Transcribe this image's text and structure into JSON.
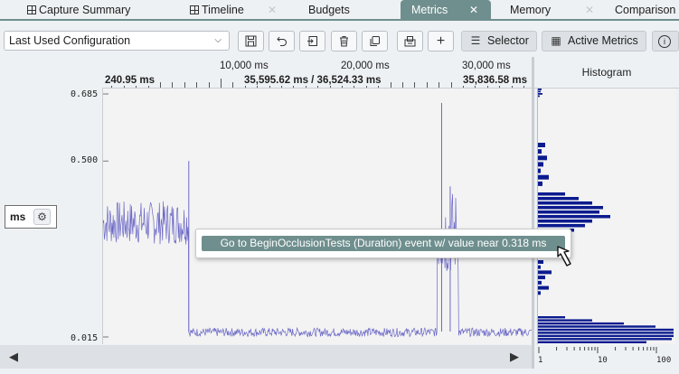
{
  "tabs": [
    {
      "label": "Capture Summary",
      "icon": "grid-icon"
    },
    {
      "label": "Timeline",
      "icon": "grid-icon"
    },
    {
      "label": "Budgets"
    },
    {
      "label": "Metrics",
      "active": true
    },
    {
      "label": "Memory"
    },
    {
      "label": "Comparison"
    }
  ],
  "tab_close_glyph": "✕",
  "toolbar": {
    "config_value": "Last Used Configuration",
    "selector_label": "Selector",
    "active_metrics_label": "Active Metrics",
    "icons": [
      "save-icon",
      "undo-icon",
      "export-icon",
      "delete-icon",
      "copy-icon",
      "import-icon",
      "add-icon",
      "list-icon",
      "calculator-icon",
      "info-icon"
    ]
  },
  "ruler": {
    "ticks": [
      "10,000 ms",
      "20,000 ms",
      "30,000 ms"
    ],
    "range_start": "240.95 ms",
    "range_center": "35,595.62 ms / 36,524.33 ms",
    "range_end": "35,836.58 ms"
  },
  "axis": {
    "y_labels": [
      "0.685",
      "0.500",
      "0.015"
    ],
    "unit": "ms"
  },
  "histogram": {
    "title": "Histogram",
    "x_labels": [
      "1",
      "10",
      "100"
    ]
  },
  "tooltip": {
    "text": "Go to BeginOcclusionTests (Duration) event w/ value near 0.318 ms"
  },
  "colors": {
    "accent": "#6f8f8e",
    "series": "#6b68c6",
    "histogram": "#0b1b8f"
  },
  "chart_data": {
    "type": "line",
    "ylabel": "ms",
    "ylim": [
      0.015,
      0.685
    ],
    "y_ticks": [
      0.685,
      0.5,
      0.015
    ],
    "segments": [
      {
        "x_start": 0,
        "x_end": 0.2,
        "y_center": 0.33,
        "noise": 0.06
      },
      {
        "x_start": 0.2,
        "x_end": 0.78,
        "y_center": 0.028,
        "noise": 0.012
      },
      {
        "x_start": 0.78,
        "x_end": 0.83,
        "y_center": 0.3,
        "noise": 0.12
      },
      {
        "x_start": 0.83,
        "x_end": 1.0,
        "y_center": 0.028,
        "noise": 0.012
      }
    ],
    "spikes": [
      {
        "x": 0.2,
        "y": 0.5
      },
      {
        "x": 0.79,
        "y": 0.66
      },
      {
        "x": 0.81,
        "y": 0.43
      }
    ]
  }
}
